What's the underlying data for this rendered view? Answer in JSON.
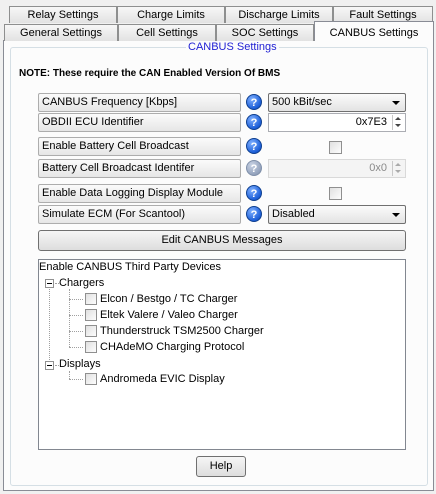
{
  "tabs_row1": [
    "Relay Settings",
    "Charge Limits",
    "Discharge Limits",
    "Fault Settings"
  ],
  "tabs_row2": [
    "General Settings",
    "Cell Settings",
    "SOC Settings",
    "CANBUS Settings"
  ],
  "group_title": "CANBUS Settings",
  "note": "NOTE: These require the CAN Enabled Version Of BMS",
  "rows": {
    "frequency": {
      "label": "CANBUS Frequency [Kbps]",
      "value": "500 kBit/sec"
    },
    "obdii": {
      "label": "OBDII ECU Identifier",
      "value": "0x7E3"
    },
    "broadcast": {
      "label": "Enable Battery Cell Broadcast",
      "checked": false
    },
    "broadcast_id": {
      "label": "Battery Cell Broadcast Identifer",
      "value": "0x0"
    },
    "logging": {
      "label": "Enable Data Logging Display Module",
      "checked": false
    },
    "simulate": {
      "label": "Simulate ECM (For Scantool)",
      "value": "Disabled"
    }
  },
  "help_glyph": "?",
  "edit_button": "Edit CANBUS Messages",
  "tree": {
    "root": "Enable CANBUS Third Party Devices",
    "chargers": {
      "label": "Chargers",
      "items": [
        "Elcon / Bestgo / TC Charger",
        "Eltek Valere / Valeo Charger",
        "Thunderstruck TSM2500 Charger",
        "CHAdeMO Charging Protocol"
      ]
    },
    "displays": {
      "label": "Displays",
      "items": [
        "Andromeda EVIC Display"
      ]
    }
  },
  "help_button": "Help",
  "icons": {
    "help": "help-icon",
    "dropdown": "chevron-down-icon",
    "spin": "spin-arrows-icon",
    "expander": "collapse-icon"
  }
}
